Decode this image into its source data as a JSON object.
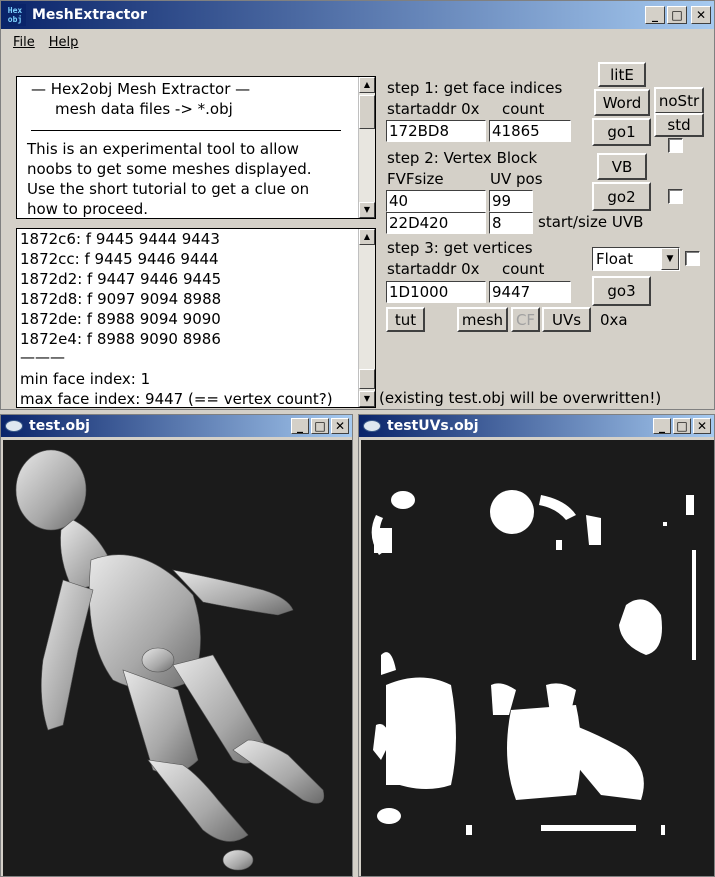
{
  "main": {
    "title": "MeshExtractor",
    "icon_text": "Hex obj",
    "menu": [
      "File",
      "Help"
    ]
  },
  "info": {
    "lines": [
      "—  Hex2obj Mesh Extractor  —",
      "mesh data files -> *.obj",
      "This is an experimental tool to allow",
      "noobs to get some meshes displayed.",
      "Use the short tutorial to get a clue on",
      "how to proceed."
    ]
  },
  "log": {
    "lines": [
      "1872c6: f  9445 9444 9443",
      "1872cc: f  9445 9446 9444",
      "1872d2: f  9447 9446 9445",
      "1872d8: f  9097 9094 8988",
      "1872de: f  8988 9094 9090",
      "1872e4: f  8988 9090 8986",
      "———",
      "min face index: 1",
      "max face index: 9447 (== vertex count?)"
    ]
  },
  "step1": {
    "title": "step 1: get face indices",
    "addr_label": "startaddr 0x",
    "count_label": "count",
    "addr": "172BD8",
    "count": "41865"
  },
  "step2": {
    "title": "step 2: Vertex Block",
    "fvf_label": "FVFsize",
    "uv_label": "UV pos",
    "fvf": "40",
    "uvpos": "99",
    "uvb_start": "22D420",
    "uvb_size": "8",
    "uvb_label": "start/size UVB"
  },
  "step3": {
    "title": "step 3: get vertices",
    "addr_label": "startaddr 0x",
    "count_label": "count",
    "addr": "1D1000",
    "count": "9447",
    "type": "Float"
  },
  "buttons": {
    "lite": "litE",
    "word": "Word",
    "nostr": "noStr",
    "go1": "go1",
    "std": "std",
    "vb": "VB",
    "go2": "go2",
    "go3": "go3",
    "tut": "tut",
    "mesh": "mesh",
    "cf": "CF",
    "uvs": "UVs",
    "hex": "0xa"
  },
  "warning": "(existing test.obj will be overwritten!)",
  "objwin": {
    "title": "test.obj"
  },
  "uvwin": {
    "title": "testUVs.obj"
  },
  "icons": {
    "minimize": "minimize-icon",
    "maximize": "maximize-icon",
    "close": "close-icon"
  }
}
